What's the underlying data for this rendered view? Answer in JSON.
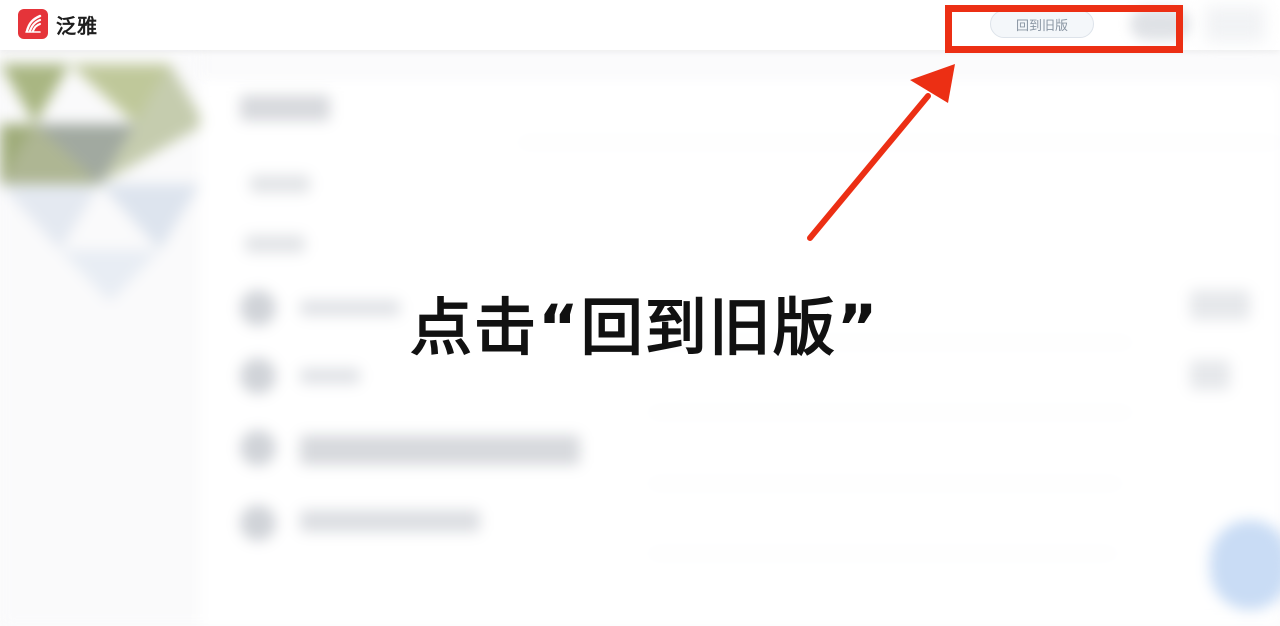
{
  "app": {
    "name": "泛雅",
    "brand_color": "#e5343a"
  },
  "header": {
    "old_version_label": "回到旧版"
  },
  "annotation": {
    "instruction": "点击“回到旧版”",
    "highlight_color": "#ec2f14",
    "arrow_color": "#ec2f14"
  }
}
